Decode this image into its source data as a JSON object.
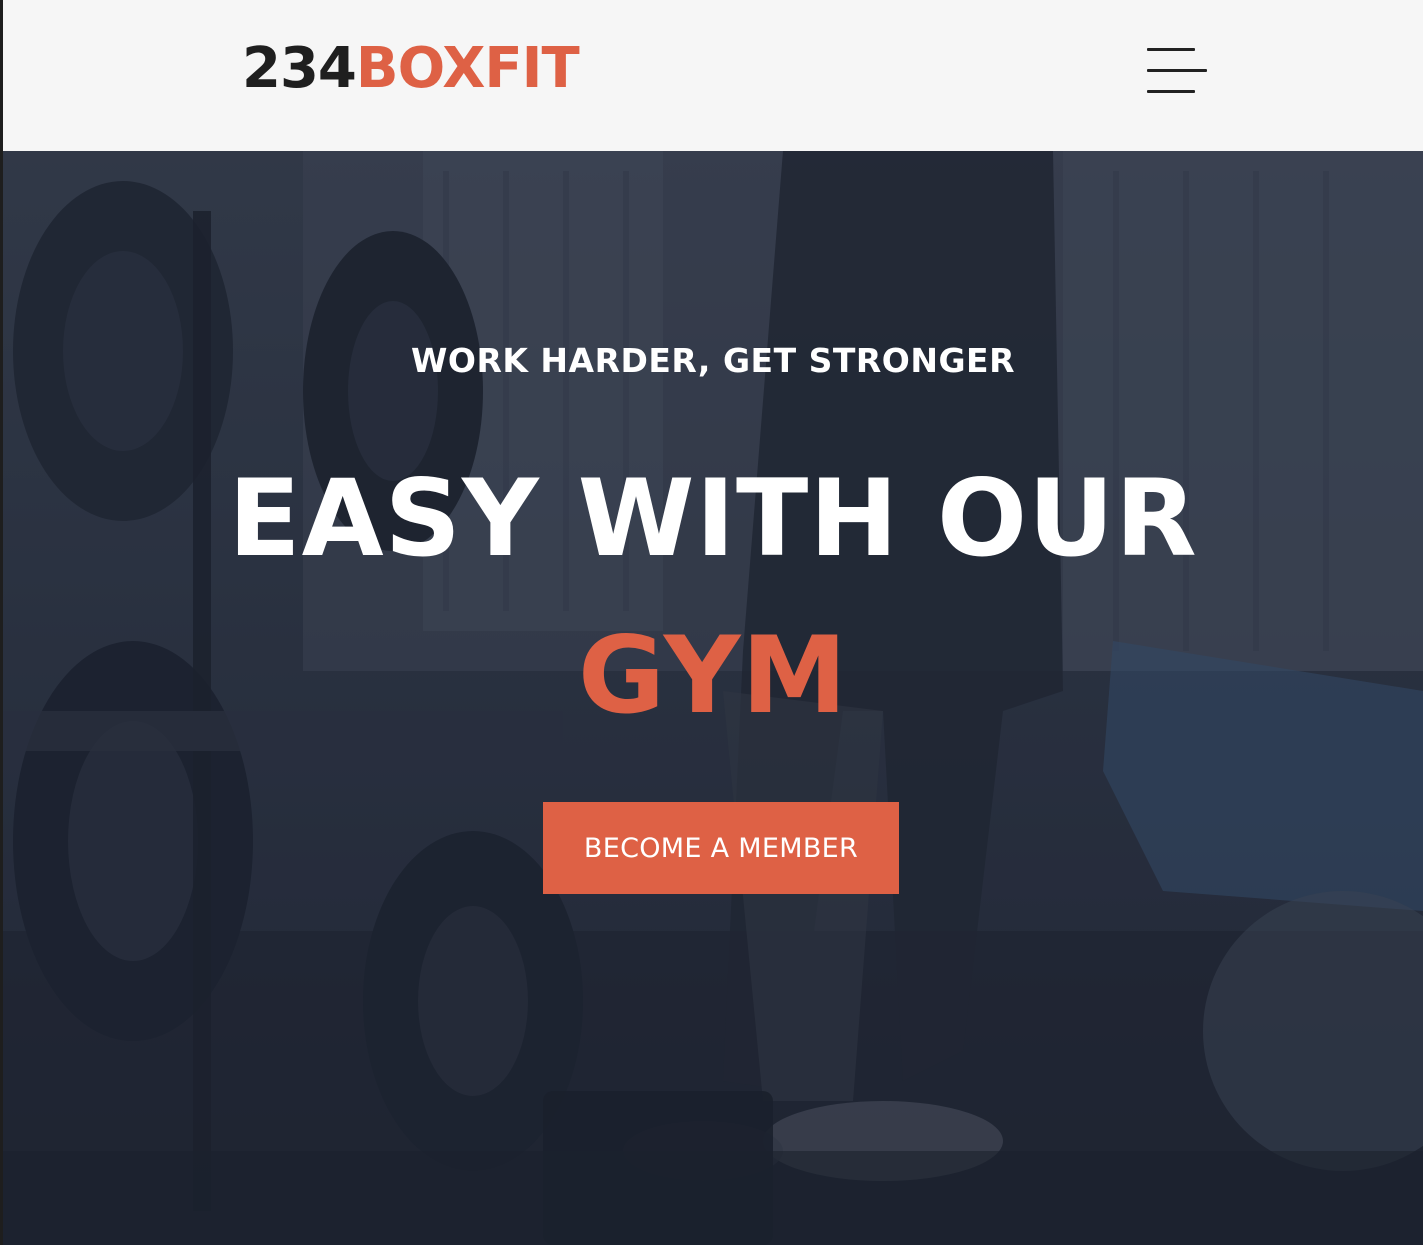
{
  "header": {
    "logo_number": "234",
    "logo_word": "BOXFIT"
  },
  "hero": {
    "tagline": "WORK HARDER, GET STRONGER",
    "headline": "EASY WITH OUR",
    "headline_accent": "GYM",
    "cta_label": "BECOME A MEMBER"
  },
  "colors": {
    "accent": "#de6145",
    "header_bg": "#f6f6f6",
    "logo_dark": "#1f1f1f",
    "hero_overlay": "#262c3a",
    "text_light": "#ffffff"
  },
  "icons": {
    "menu": "hamburger-menu-icon"
  }
}
